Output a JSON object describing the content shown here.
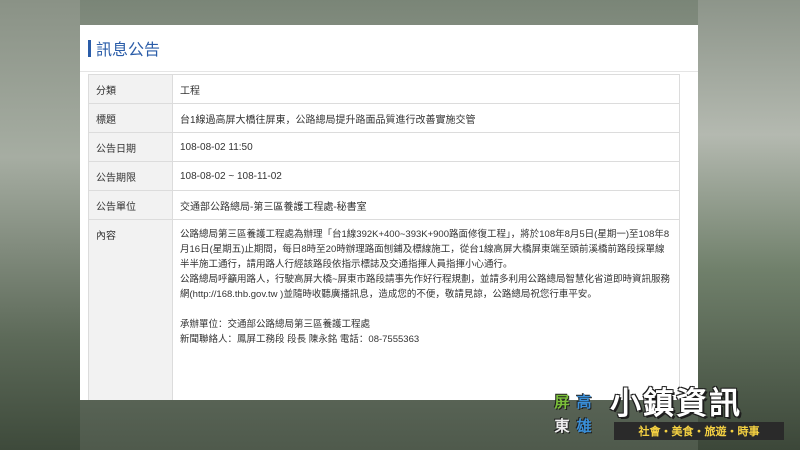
{
  "panel": {
    "title": "訊息公告"
  },
  "rows": [
    {
      "label": "分類",
      "value": "工程"
    },
    {
      "label": "標題",
      "value": "台1線過高屏大橋往屏東，公路總局提升路面品質進行改善實施交管"
    },
    {
      "label": "公告日期",
      "value": "108-08-02 11:50"
    },
    {
      "label": "公告期限",
      "value": "108-08-02 ~ 108-11-02"
    },
    {
      "label": "公告單位",
      "value": "交通部公路總局-第三區養護工程處-秘書室"
    },
    {
      "label": "內容",
      "value": "公路總局第三區養護工程處為辦理「台1線392K+400~393K+900路面修復工程」，將於108年8月5日(星期一)至108年8月16日(星期五)止期間，每日8時至20時辦理路面刨鋪及標線施工，從台1線高屏大橋屏東端至頭前溪橋前路段採單線半半施工通行，請用路人行經該路段依指示標誌及交通指揮人員指揮小心通行。\n公路總局呼籲用路人，行駛高屏大橋~屏東市路段請事先作好行程規劃，並請多利用公路總局智慧化省道即時資訊服務網(http://168.thb.gov.tw )並隨時收聽廣播訊息，造成您的不便，敬請見諒，公路總局祝您行車平安。\n\n承辦單位：交通部公路總局第三區養護工程處\n新聞聯絡人：鳳屏工務段 段長 陳永銘 電話：08-7555363"
    }
  ],
  "brand": {
    "region_chars": [
      "屏",
      "高",
      "東",
      "雄"
    ],
    "name": "小鎮資訊",
    "tagline": "社會・美食・旅遊・時事",
    "colors": {
      "ping": "#7bbf3a",
      "gao": "#3a8fd8",
      "dong": "#f0f0f0",
      "xiong": "#3a8fd8"
    }
  }
}
